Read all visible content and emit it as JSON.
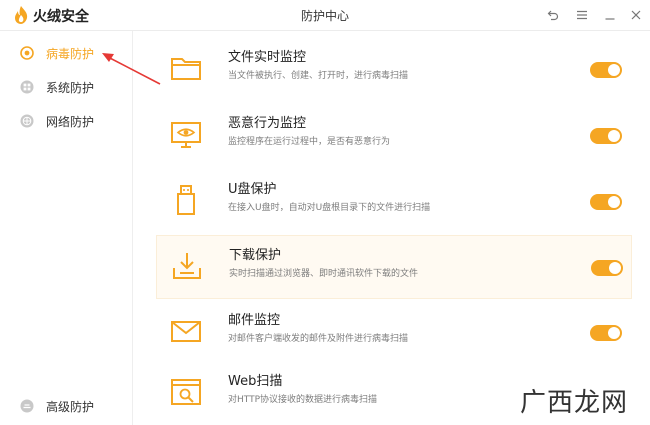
{
  "app": {
    "name": "火绒安全",
    "window_title": "防护中心",
    "brand_color": "#f5a623"
  },
  "titlebar_buttons": [
    {
      "icon": "back-icon"
    },
    {
      "icon": "menu-icon"
    },
    {
      "icon": "minimize-icon"
    },
    {
      "icon": "close-icon"
    }
  ],
  "sidebar": {
    "items": [
      {
        "label": "病毒防护",
        "icon": "virus-protection-icon",
        "active": true
      },
      {
        "label": "系统防护",
        "icon": "system-protection-icon",
        "active": false
      },
      {
        "label": "网络防护",
        "icon": "network-protection-icon",
        "active": false
      }
    ],
    "bottom_item": {
      "label": "高级防护",
      "icon": "advanced-protection-icon"
    }
  },
  "features": [
    {
      "title": "文件实时监控",
      "desc": "当文件被执行、创建、打开时，进行病毒扫描",
      "icon": "folder-icon",
      "enabled": true
    },
    {
      "title": "恶意行为监控",
      "desc": "监控程序在运行过程中，是否有恶意行为",
      "icon": "monitor-eye-icon",
      "enabled": true
    },
    {
      "title": "U盘保护",
      "desc": "在接入U盘时，自动对U盘根目录下的文件进行扫描",
      "icon": "usb-drive-icon",
      "enabled": true
    },
    {
      "title": "下载保护",
      "desc": "实时扫描通过浏览器、即时通讯软件下载的文件",
      "icon": "download-icon",
      "enabled": true
    },
    {
      "title": "邮件监控",
      "desc": "对邮件客户端收发的邮件及附件进行病毒扫描",
      "icon": "mail-icon",
      "enabled": true
    },
    {
      "title": "Web扫描",
      "desc": "对HTTP协议接收的数据进行病毒扫描",
      "icon": "web-scan-icon",
      "enabled": true
    }
  ],
  "watermark": {
    "text": "广西龙网"
  }
}
